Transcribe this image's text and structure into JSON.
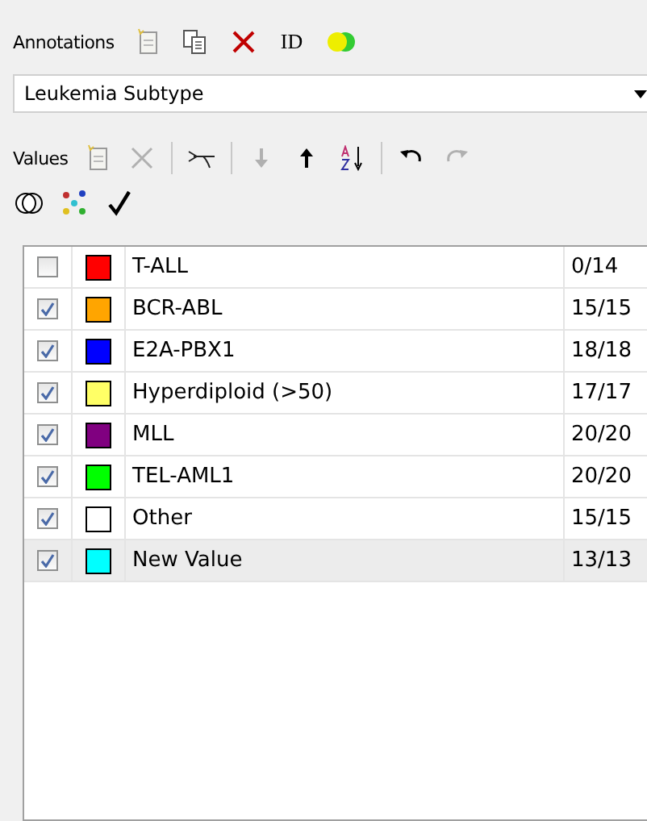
{
  "annotations": {
    "label": "Annotations",
    "id_label": "ID"
  },
  "dropdown": {
    "value": "Leukemia Subtype"
  },
  "values_toolbar": {
    "label": "Values",
    "undo_disabled": false,
    "redo_disabled": true,
    "delete_disabled": true,
    "move_down_disabled": true
  },
  "values": [
    {
      "name": "T-ALL",
      "checked": false,
      "color": "#ff0000",
      "count": "0/14",
      "selected": false
    },
    {
      "name": "BCR-ABL",
      "checked": true,
      "color": "#ffa500",
      "count": "15/15",
      "selected": false
    },
    {
      "name": "E2A-PBX1",
      "checked": true,
      "color": "#0000ff",
      "count": "18/18",
      "selected": false
    },
    {
      "name": "Hyperdiploid (>50)",
      "checked": true,
      "color": "#ffff66",
      "count": "17/17",
      "selected": false
    },
    {
      "name": "MLL",
      "checked": true,
      "color": "#800080",
      "count": "20/20",
      "selected": false
    },
    {
      "name": "TEL-AML1",
      "checked": true,
      "color": "#00ff00",
      "count": "20/20",
      "selected": false
    },
    {
      "name": "Other",
      "checked": true,
      "color": "#ffffff",
      "count": "15/15",
      "selected": false
    },
    {
      "name": "New Value",
      "checked": true,
      "color": "#00ffff",
      "count": "13/13",
      "selected": true
    }
  ]
}
